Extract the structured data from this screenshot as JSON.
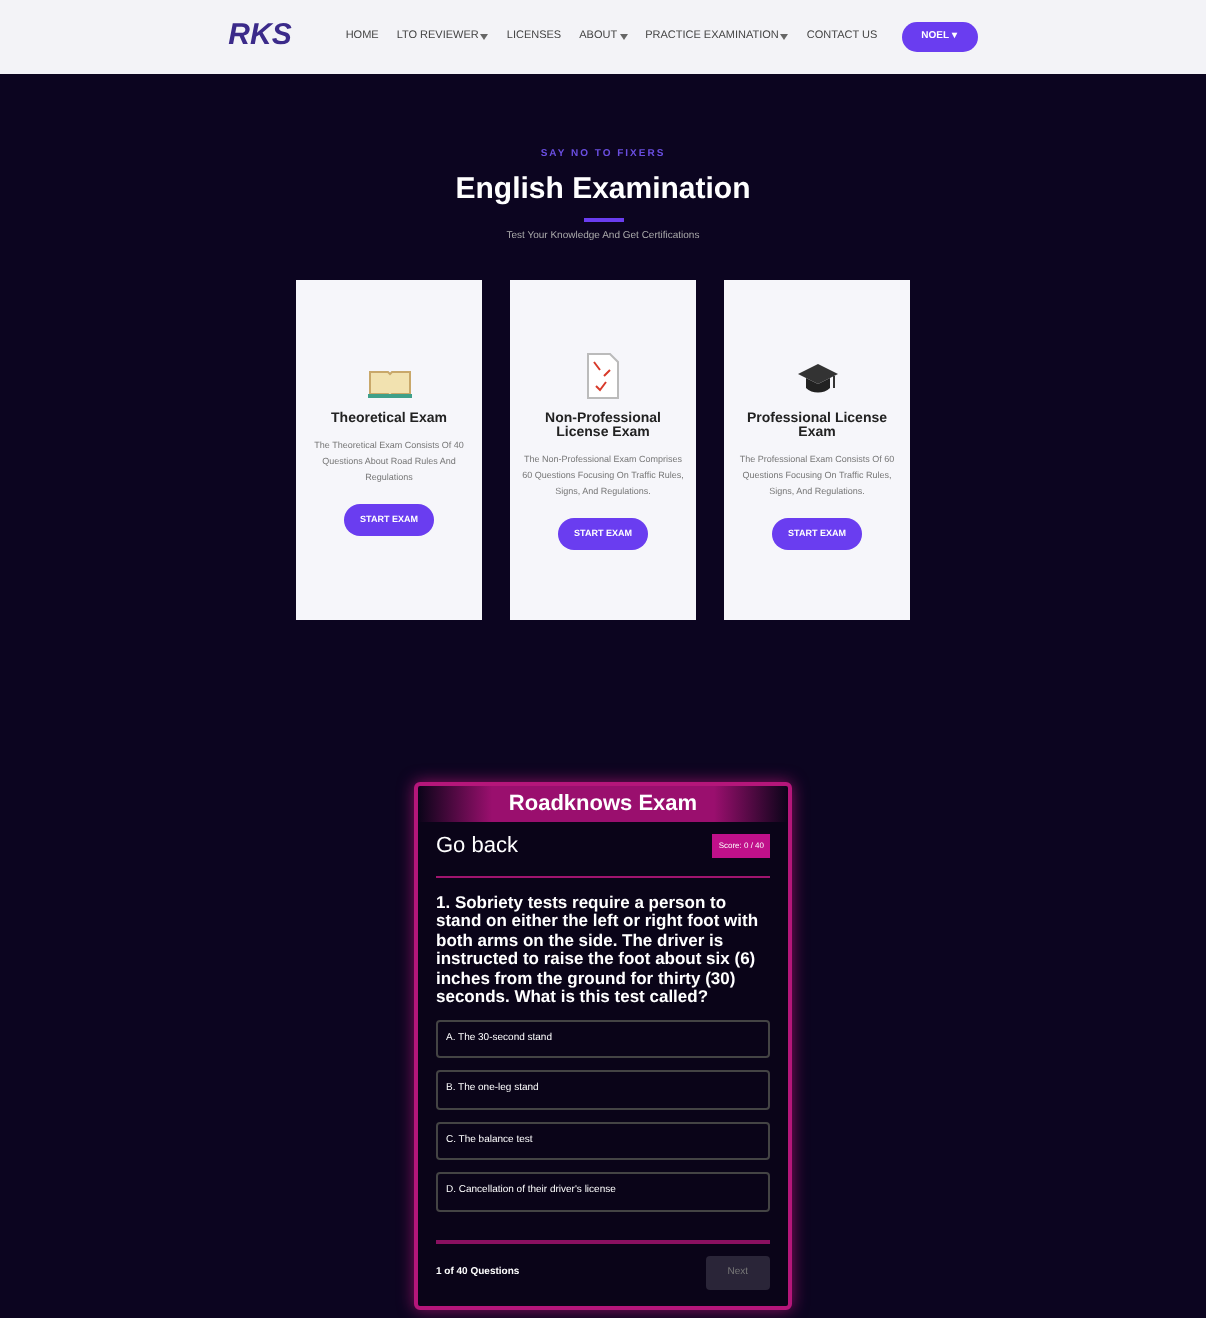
{
  "nav": {
    "logo": "RKS",
    "items": [
      {
        "label": "HOME",
        "dropdown": false
      },
      {
        "label": "LTO REVIEWER",
        "dropdown": true
      },
      {
        "label": "LICENSES",
        "dropdown": false
      },
      {
        "label": "ABOUT",
        "dropdown": true
      },
      {
        "label": "PRACTICE EXAMINATION",
        "dropdown": true
      },
      {
        "label": "CONTACT US",
        "dropdown": false
      }
    ],
    "user_button": "NOEL ▾"
  },
  "hero": {
    "eyebrow": "SAY NO TO FIXERS",
    "title": "English Examination",
    "subtitle": "Test Your Knowledge And Get Certifications"
  },
  "cards": [
    {
      "kind": "book",
      "title": "Theoretical Exam",
      "text": "The Theoretical Exam Consists Of 40 Questions About Road Rules And Regulations",
      "button": "START EXAM"
    },
    {
      "kind": "paper",
      "title": "Non-Professional License Exam",
      "text": "The Non-Professional Exam Comprises 60 Questions Focusing On Traffic Rules, Signs, And Regulations.",
      "button": "START EXAM"
    },
    {
      "kind": "cap",
      "title": "Professional License Exam",
      "text": "The Professional Exam Consists Of 60 Questions Focusing On Traffic Rules, Signs, And Regulations.",
      "button": "START EXAM"
    }
  ],
  "quiz": {
    "title": "Roadknows Exam",
    "back": "Go back",
    "score": "Score: 0 / 40",
    "question": "1. Sobriety tests require a person to stand on either the left or right foot with both arms on the side. The driver is instructed to raise the foot about six (6) inches from the ground for thirty (30) seconds. What is this test called?",
    "options": [
      {
        "label": "A. The 30-second stand",
        "selected": false
      },
      {
        "label": "B. The one-leg stand",
        "selected": false
      },
      {
        "label": "C. The balance test",
        "selected": false
      },
      {
        "label": "D. Cancellation of their driver's license",
        "selected": false
      }
    ],
    "progress": "1 of 40 Questions",
    "next": {
      "label": "Next",
      "disabled": true
    }
  }
}
